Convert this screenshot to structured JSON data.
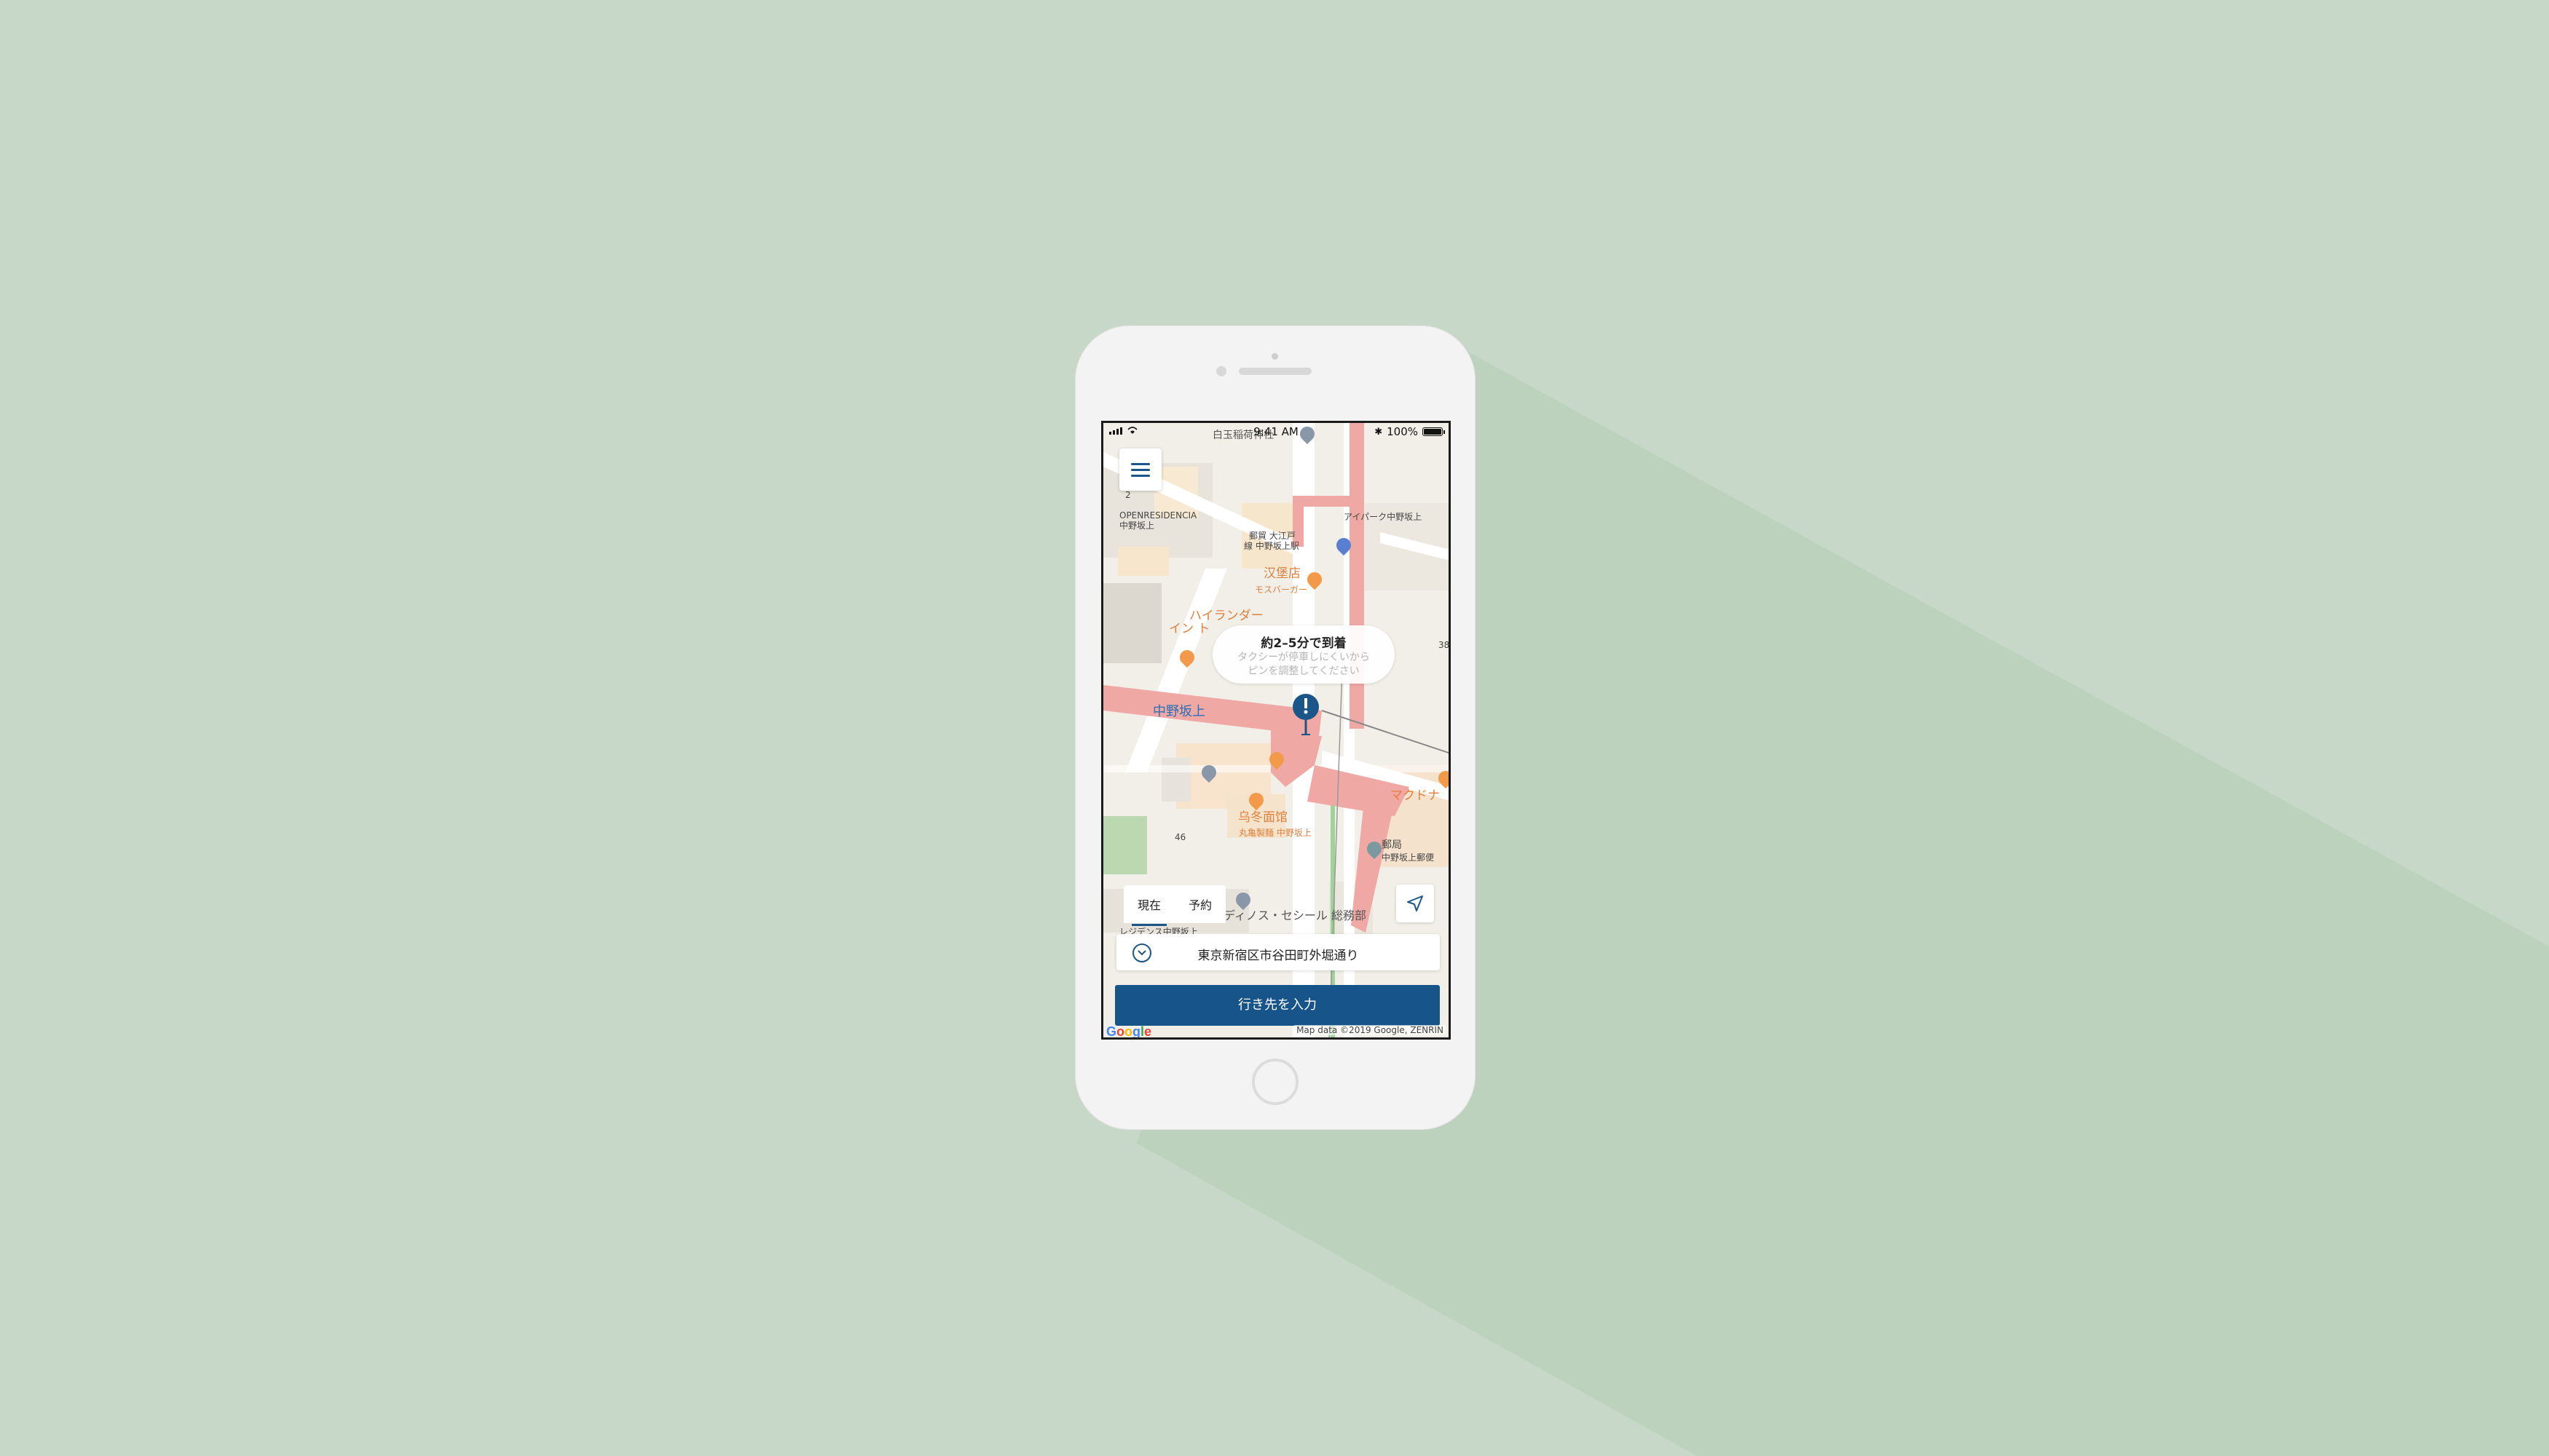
{
  "status_bar": {
    "time": "9:41 AM",
    "battery": "100%",
    "battery_level": 1.0
  },
  "menu_button": {
    "icon": "hamburger-menu-icon"
  },
  "eta": {
    "title": "約2–5分で到着",
    "subtitle_line1": "タクシーが停車しにくいから",
    "subtitle_line2": "ピンを調整してください"
  },
  "map_labels": {
    "shiratama": "白玉稲荷神社",
    "openresidencia_1": "OPENRESIDENCIA",
    "openresidencia_2": "中野坂上",
    "yubin_1": "郵貿 大江戸",
    "yubin_2": "線 中野坂上駅",
    "apark": "アイパーク中野坂上",
    "hanbao": "汉堡店",
    "mos": "モスバーガー",
    "highlander_1": "ハイランダー",
    "highlander_2": "イン ト",
    "station": "中野坂上",
    "num_38": "38",
    "num_46": "46",
    "num_2": "2",
    "udon_1": "乌冬面馆",
    "udon_2": "丸亀製麺 中野坂上",
    "mac": "マクドナ",
    "post_1": "郵局",
    "post_2": "中野坂上郵便",
    "residence": "レジデンス中野坂上",
    "sealnote": "ディノス・セシール 総務部"
  },
  "tabs": [
    {
      "label": "現在",
      "active": true
    },
    {
      "label": "予約",
      "active": false
    }
  ],
  "locate_button": {
    "icon": "navigation-arrow-icon"
  },
  "address": {
    "icon": "chevron-down-icon",
    "text": "東京新宿区市谷田町外堀通り"
  },
  "destination_button": {
    "label": "行き先を入力"
  },
  "map_footer": {
    "logo": "Google",
    "credit": "Map data ©2019 Google, ZENRIN"
  },
  "colors": {
    "accent": "#175489",
    "background": "#c7d8c8",
    "road_highlight": "#f0a8a4"
  }
}
